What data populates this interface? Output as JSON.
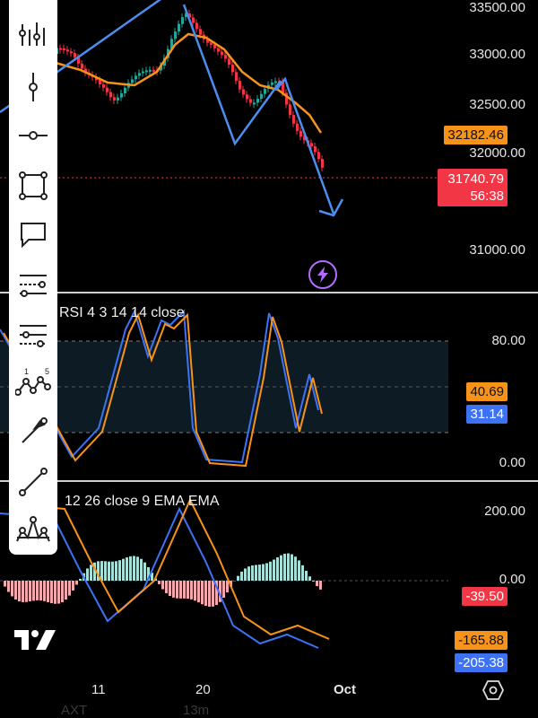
{
  "price_axis": {
    "labels": [
      "33500.00",
      "33000.00",
      "32500.00",
      "32000.00",
      "31000.00"
    ],
    "ema_tag": "32182.46",
    "last_price_tag": "31740.79",
    "countdown": "56:38"
  },
  "rsi": {
    "title": "RSI 4 3 14 14 close",
    "axis_labels": [
      "80.00",
      "0.00"
    ],
    "tag_orange": "40.69",
    "tag_blue": "31.14"
  },
  "macd": {
    "title": "12 26 close 9 EMA EMA",
    "axis_labels": [
      "200.00",
      "0.00"
    ],
    "tag_hist": "-39.50",
    "tag_orange": "-165.88",
    "tag_blue": "-205.38"
  },
  "time_axis": {
    "labels": [
      "11",
      "20",
      "Oct"
    ],
    "faded_labels": [
      "AXT",
      "13m"
    ]
  },
  "colors": {
    "background": "#000000",
    "orange": "#f7931a",
    "blue": "#3d72f5",
    "red": "#f23645",
    "green": "#26a69a",
    "drawing_blue": "#4c8df0",
    "rsi_band": "#0d1b24"
  },
  "toolbar": {
    "tools": [
      "cursor-tools-icon",
      "vertical-line-icon",
      "horizontal-line-icon",
      "rectangle-icon",
      "comment-icon",
      "fib-retracement-icon",
      "pitchfork-icon",
      "xabcd-pattern-icon",
      "arrow-icon",
      "trend-line-icon",
      "head-shoulders-icon"
    ]
  },
  "xabcd_labels": [
    "1",
    "5"
  ]
}
